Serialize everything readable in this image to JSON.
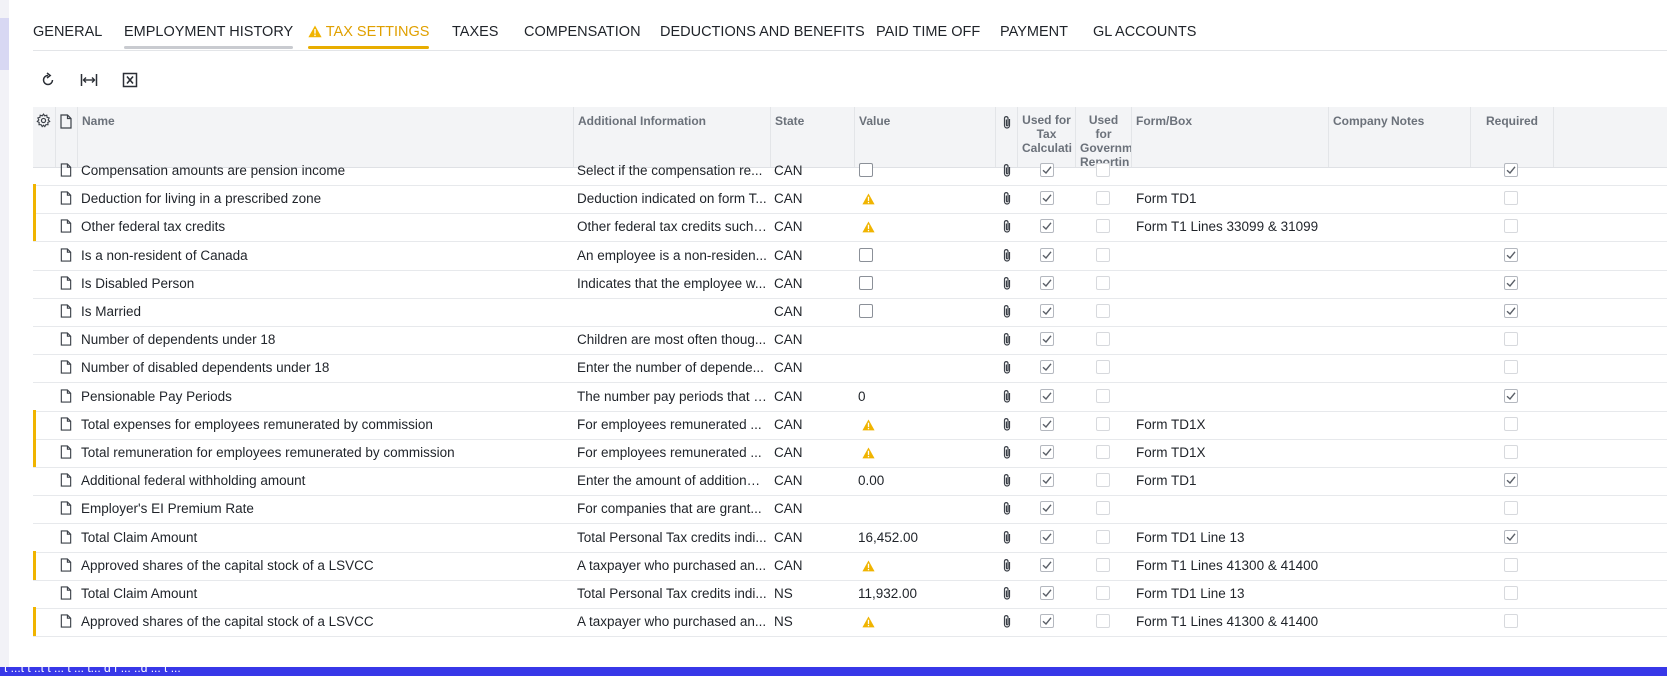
{
  "tabs": [
    {
      "label": "GENERAL"
    },
    {
      "label": "EMPLOYMENT HISTORY"
    },
    {
      "label": "TAX SETTINGS",
      "warning": true
    },
    {
      "label": "TAXES"
    },
    {
      "label": "COMPENSATION"
    },
    {
      "label": "DEDUCTIONS AND BENEFITS"
    },
    {
      "label": "PAID TIME OFF"
    },
    {
      "label": "PAYMENT"
    },
    {
      "label": "GL ACCOUNTS"
    }
  ],
  "active_tab": "TAX SETTINGS",
  "toolbar": {
    "refresh_icon": "refresh-icon",
    "fit_columns_icon": "fit-to-width-icon",
    "export_icon": "excel-export-icon"
  },
  "columns": {
    "name": "Name",
    "additional_info": "Additional Information",
    "state": "State",
    "value": "Value",
    "used_for_tax": "Used for Tax Calculati",
    "used_for_gov": "Used for Governm Reportin",
    "form_box": "Form/Box",
    "company_notes": "Company Notes",
    "required": "Required"
  },
  "rows": [
    {
      "name": "Compensation amounts are pension income",
      "info": "Select if the compensation re...",
      "state": "CAN",
      "value_kind": "checkbox",
      "value_checked": false,
      "value_text": "",
      "warn": false,
      "tax": true,
      "gov": false,
      "form": "",
      "required": true
    },
    {
      "name": "Deduction for living in a prescribed zone",
      "info": "Deduction indicated on form T...",
      "state": "CAN",
      "value_kind": "warning",
      "value_checked": false,
      "value_text": "",
      "warn": true,
      "tax": true,
      "gov": false,
      "form": "Form TD1",
      "required": false
    },
    {
      "name": "Other federal tax credits",
      "info": "Other federal tax credits such ...",
      "state": "CAN",
      "value_kind": "warning",
      "value_checked": false,
      "value_text": "",
      "warn": true,
      "tax": true,
      "gov": false,
      "form": "Form T1 Lines 33099 & 31099",
      "required": false
    },
    {
      "name": "Is a non-resident of Canada",
      "info": "An employee is a non-residen...",
      "state": "CAN",
      "value_kind": "checkbox",
      "value_checked": false,
      "value_text": "",
      "warn": false,
      "tax": true,
      "gov": false,
      "form": "",
      "required": true
    },
    {
      "name": "Is Disabled Person",
      "info": "Indicates that the employee w...",
      "state": "CAN",
      "value_kind": "checkbox",
      "value_checked": false,
      "value_text": "",
      "warn": false,
      "tax": true,
      "gov": false,
      "form": "",
      "required": true
    },
    {
      "name": "Is Married",
      "info": "",
      "state": "CAN",
      "value_kind": "checkbox",
      "value_checked": false,
      "value_text": "",
      "warn": false,
      "tax": true,
      "gov": false,
      "form": "",
      "required": true
    },
    {
      "name": "Number of dependents under 18",
      "info": "Children are most often thoug...",
      "state": "CAN",
      "value_kind": "text",
      "value_checked": false,
      "value_text": "",
      "warn": false,
      "tax": true,
      "gov": false,
      "form": "",
      "required": false
    },
    {
      "name": "Number of disabled dependents under 18",
      "info": "Enter the number of depende...",
      "state": "CAN",
      "value_kind": "text",
      "value_checked": false,
      "value_text": "",
      "warn": false,
      "tax": true,
      "gov": false,
      "form": "",
      "required": false
    },
    {
      "name": "Pensionable Pay Periods",
      "info": "The number pay periods that i...",
      "state": "CAN",
      "value_kind": "text",
      "value_checked": false,
      "value_text": "0",
      "warn": false,
      "tax": true,
      "gov": false,
      "form": "",
      "required": true
    },
    {
      "name": "Total expenses for employees remunerated by commission",
      "info": "For employees remunerated ...",
      "state": "CAN",
      "value_kind": "warning",
      "value_checked": false,
      "value_text": "",
      "warn": true,
      "tax": true,
      "gov": false,
      "form": "Form TD1X",
      "required": false
    },
    {
      "name": "Total remuneration for employees remunerated by commission",
      "info": "For employees remunerated ...",
      "state": "CAN",
      "value_kind": "warning",
      "value_checked": false,
      "value_text": "",
      "warn": true,
      "tax": true,
      "gov": false,
      "form": "Form TD1X",
      "required": false
    },
    {
      "name": "Additional federal withholding amount",
      "info": "Enter the amount of additional...",
      "state": "CAN",
      "value_kind": "text",
      "value_checked": false,
      "value_text": "0.00",
      "warn": false,
      "tax": true,
      "gov": false,
      "form": "Form TD1",
      "required": true
    },
    {
      "name": "Employer's EI Premium Rate",
      "info": "For companies that are grant...",
      "state": "CAN",
      "value_kind": "text",
      "value_checked": false,
      "value_text": "",
      "warn": false,
      "tax": true,
      "gov": false,
      "form": "",
      "required": false
    },
    {
      "name": "Total Claim Amount",
      "info": "Total Personal Tax credits indi...",
      "state": "CAN",
      "value_kind": "text",
      "value_checked": false,
      "value_text": "16,452.00",
      "warn": false,
      "tax": true,
      "gov": false,
      "form": "Form TD1 Line 13",
      "required": true
    },
    {
      "name": "Approved shares of the capital stock of a LSVCC",
      "info": "A taxpayer who purchased an...",
      "state": "CAN",
      "value_kind": "warning",
      "value_checked": false,
      "value_text": "",
      "warn": true,
      "tax": true,
      "gov": false,
      "form": "Form T1 Lines 41300 & 41400",
      "required": false
    },
    {
      "name": "Total Claim Amount",
      "info": "Total Personal Tax credits indi...",
      "state": "NS",
      "value_kind": "text",
      "value_checked": false,
      "value_text": "11,932.00",
      "warn": false,
      "tax": true,
      "gov": false,
      "form": "Form TD1 Line 13",
      "required": false
    },
    {
      "name": "Approved shares of the capital stock of a LSVCC",
      "info": "A taxpayer who purchased an...",
      "state": "NS",
      "value_kind": "warning",
      "value_checked": false,
      "value_text": "",
      "warn": true,
      "tax": true,
      "gov": false,
      "form": "Form T1 Lines 41300 & 41400",
      "required": false
    }
  ],
  "status_bar": {
    "text": "t ...t t ..t t ... t ... t... d f ... ..d ... t ..."
  },
  "colors": {
    "accent": "#e8ad00",
    "warning": "#f0b400",
    "status_bar": "#3838e8"
  }
}
